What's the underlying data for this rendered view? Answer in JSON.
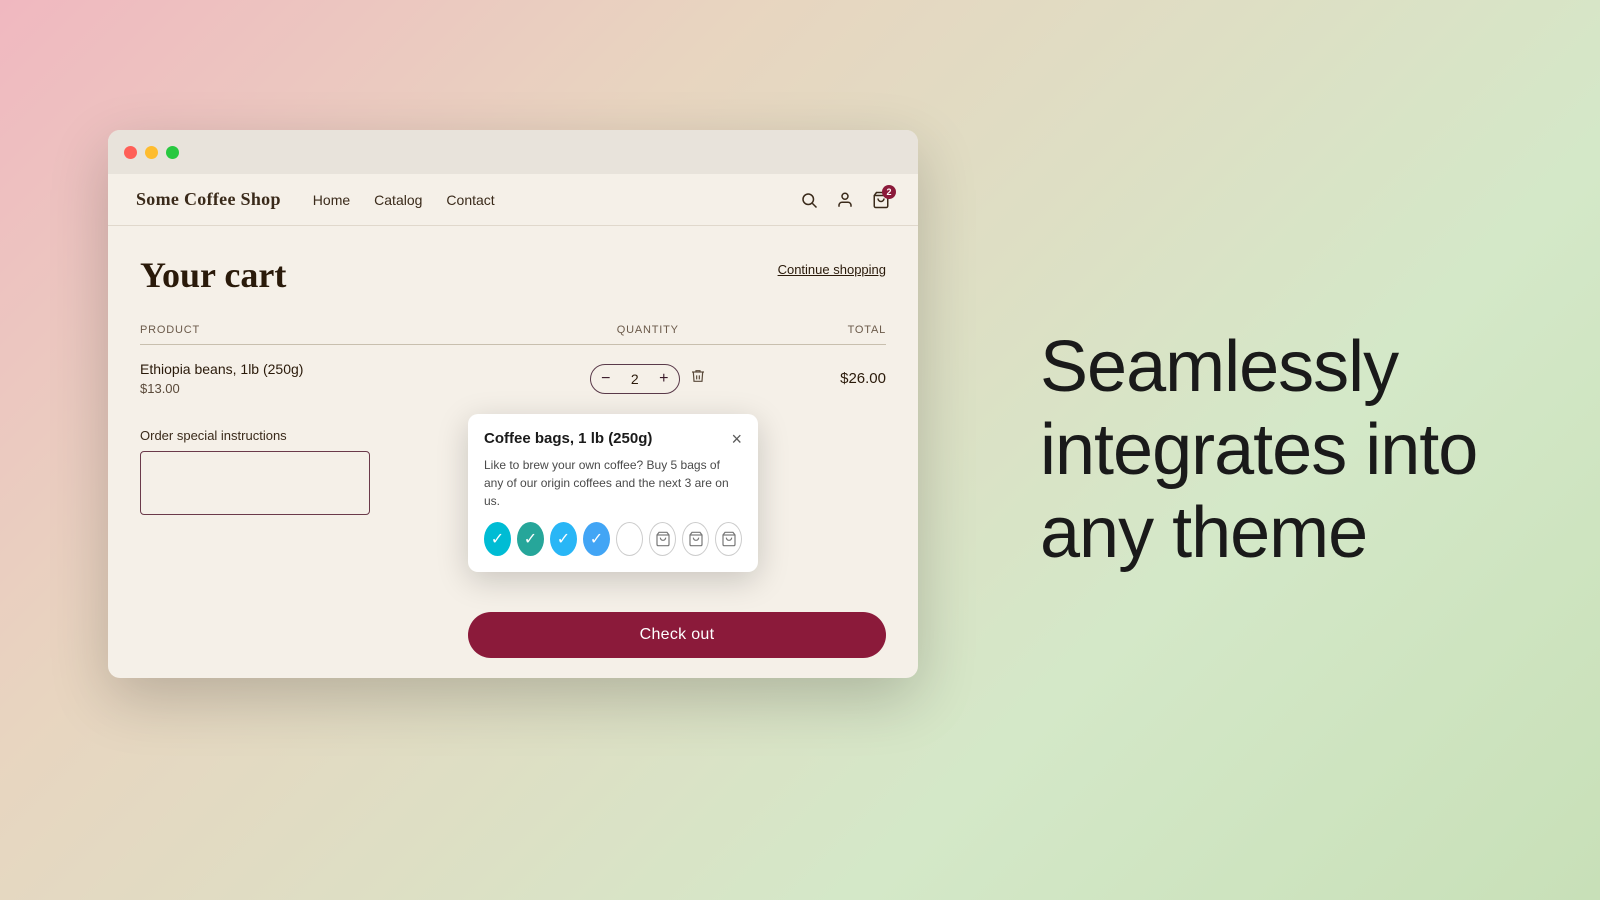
{
  "background": {
    "gradient": "linear-gradient(135deg, #f0b8c0, #e8d5c0, #d4e8c8, #c8e0b8)"
  },
  "right_text": {
    "line1": "Seamlessly",
    "line2": "integrates into",
    "line3": "any theme"
  },
  "browser": {
    "traffic_lights": [
      "red",
      "yellow",
      "green"
    ]
  },
  "nav": {
    "brand": "Some Coffee Shop",
    "links": [
      "Home",
      "Catalog",
      "Contact"
    ],
    "cart_count": "2"
  },
  "cart": {
    "title": "Your cart",
    "continue_shopping": "Continue shopping",
    "columns": {
      "product": "PRODUCT",
      "quantity": "QUANTITY",
      "total": "TOTAL"
    },
    "items": [
      {
        "name": "Ethiopia beans, 1lb (250g)",
        "price": "$13.00",
        "quantity": 2,
        "total": "$26.00"
      }
    ],
    "instructions_label": "Order special instructions",
    "instructions_placeholder": ""
  },
  "popup": {
    "title": "Coffee bags, 1 lb (250g)",
    "body": "Like to brew your own coffee? Buy 5 bags of any of our origin coffees and the next 3 are on us.",
    "close_label": "×",
    "icons": [
      {
        "type": "checked-cyan"
      },
      {
        "type": "checked-teal"
      },
      {
        "type": "checked-sky"
      },
      {
        "type": "checked-blue"
      },
      {
        "type": "empty"
      },
      {
        "type": "bag1"
      },
      {
        "type": "bag1"
      },
      {
        "type": "bag1"
      }
    ]
  },
  "checkout": {
    "label": "Check out"
  }
}
